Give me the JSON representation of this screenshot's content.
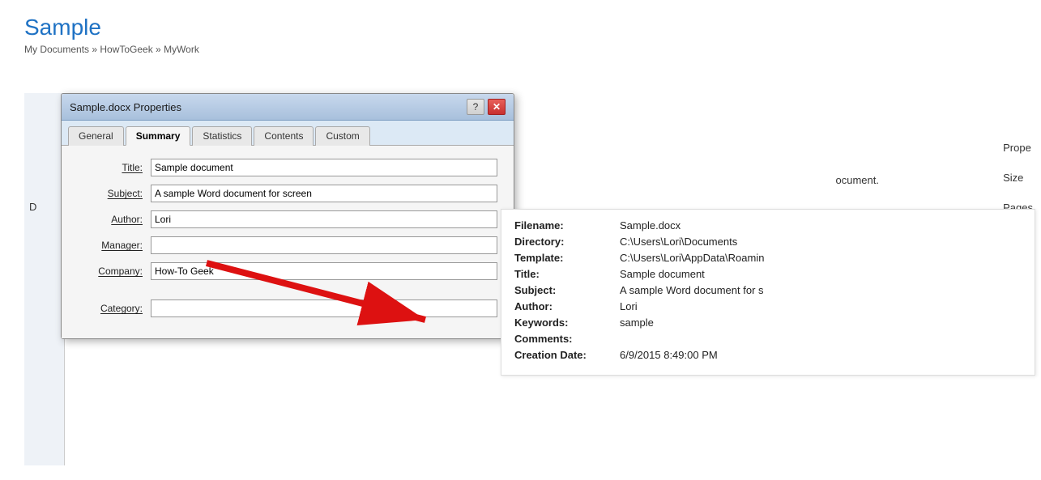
{
  "page": {
    "title": "Sample",
    "breadcrumb": "My Documents » HowToGeek » MyWork"
  },
  "dialog": {
    "title": "Sample.docx Properties",
    "help_btn": "?",
    "close_btn": "✕",
    "tabs": [
      {
        "id": "general",
        "label": "General",
        "active": false
      },
      {
        "id": "summary",
        "label": "Summary",
        "active": true
      },
      {
        "id": "statistics",
        "label": "Statistics",
        "active": false
      },
      {
        "id": "contents",
        "label": "Contents",
        "active": false
      },
      {
        "id": "custom",
        "label": "Custom",
        "active": false
      }
    ],
    "fields": [
      {
        "label": "Title:",
        "value": "Sample document",
        "underline": true
      },
      {
        "label": "Subject:",
        "value": "A sample Word document for screen",
        "underline": true
      },
      {
        "label": "Author:",
        "value": "Lori",
        "underline": true
      },
      {
        "label": "Manager:",
        "value": "",
        "underline": true
      },
      {
        "label": "Company:",
        "value": "How-To Geek",
        "underline": true
      },
      {
        "label": "Category:",
        "value": "",
        "underline": true
      }
    ]
  },
  "right_panel": {
    "doc_text": "ocument.",
    "size_label": "Size",
    "pages_label": "Pages"
  },
  "info_panel": {
    "rows": [
      {
        "label": "Filename:",
        "value": "Sample.docx"
      },
      {
        "label": "Directory:",
        "value": "C:\\Users\\Lori\\Documents"
      },
      {
        "label": "Template:",
        "value": "C:\\Users\\Lori\\AppData\\Roamin"
      },
      {
        "label": "Title:",
        "value": "Sample document"
      },
      {
        "label": "Subject:",
        "value": "A sample Word document for s"
      },
      {
        "label": "Author:",
        "value": "Lori"
      },
      {
        "label": "Keywords:",
        "value": "sample"
      },
      {
        "label": "Comments:",
        "value": ""
      },
      {
        "label": "Creation Date:",
        "value": "6/9/2015 8:49:00 PM"
      }
    ]
  }
}
